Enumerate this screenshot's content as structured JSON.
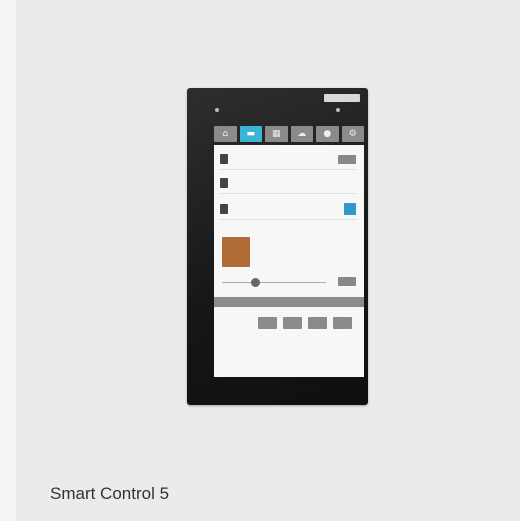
{
  "caption": "Smart Control 5",
  "device": {
    "logo_text": "",
    "tabs": [
      {
        "icon": "home-icon"
      },
      {
        "icon": "media-icon",
        "active": true
      },
      {
        "icon": "calendar-icon"
      },
      {
        "icon": "cloud-icon"
      },
      {
        "icon": "lock-icon"
      },
      {
        "icon": "settings-icon"
      }
    ],
    "rows": [
      {
        "icon": "intercom-icon",
        "action_icon": "call-button"
      },
      {
        "icon": "phone-icon",
        "action_icon": "status"
      },
      {
        "icon": "media-player-icon",
        "action_icon": "play-button"
      }
    ],
    "slider_position": 0.28
  },
  "colors": {
    "accent": "#3bb5d6",
    "album_art": "#b06a35",
    "bezel": "#161616"
  }
}
